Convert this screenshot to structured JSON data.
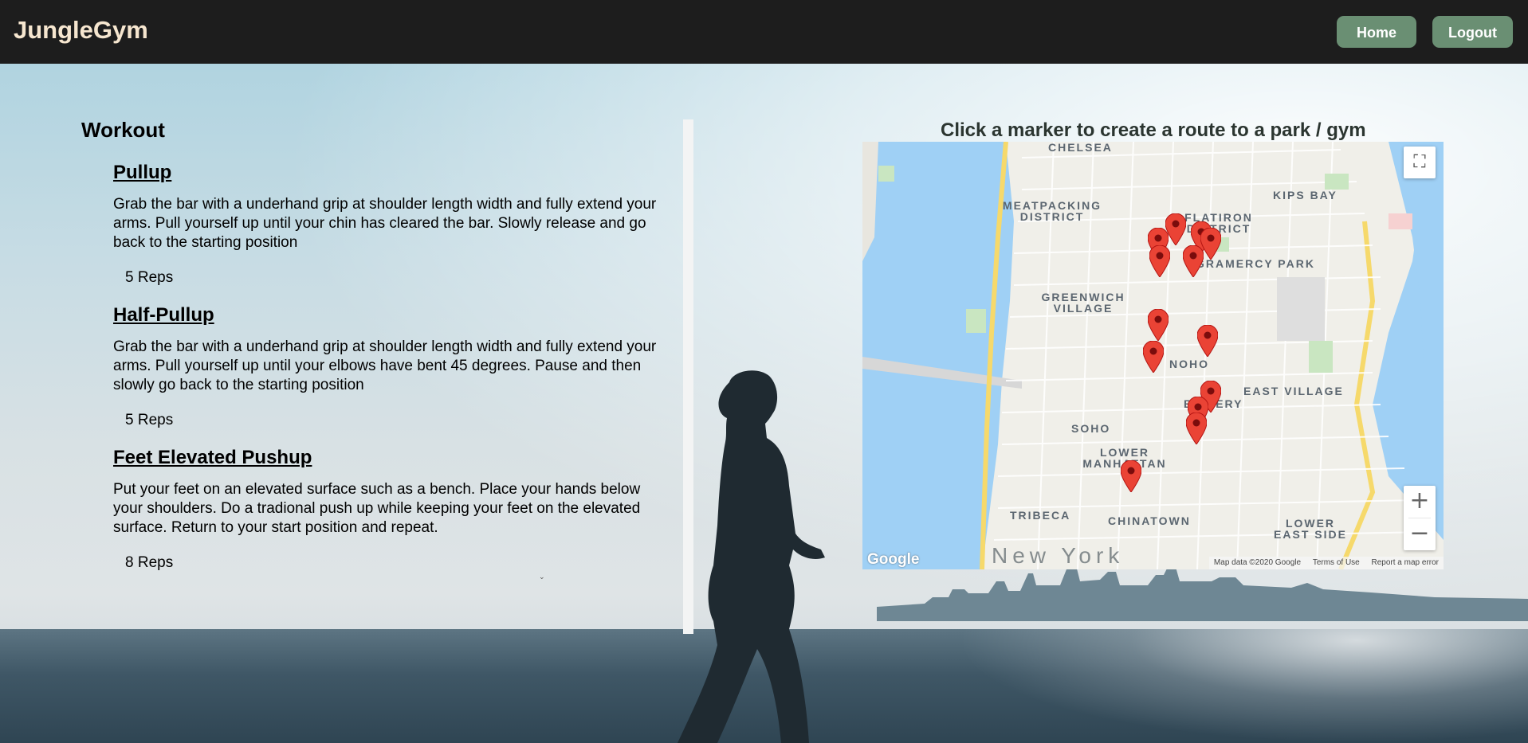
{
  "header": {
    "brand": "JungleGym",
    "home_label": "Home",
    "logout_label": "Logout"
  },
  "workout": {
    "heading": "Workout",
    "exercises": [
      {
        "title": "Pullup",
        "description": "Grab the bar with a underhand grip at shoulder length width and fully extend your arms. Pull yourself up until your chin has cleared the bar. Slowly release and go back to the starting position",
        "reps": "5 Reps"
      },
      {
        "title": "Half-Pullup",
        "description": "Grab the bar with a underhand grip at shoulder length width and fully extend your arms. Pull yourself up until your elbows have bent 45 degrees. Pause and then slowly go back to the starting position",
        "reps": "5 Reps"
      },
      {
        "title": "Feet Elevated Pushup",
        "description": "Put your feet on an elevated surface such as a bench. Place your hands below your shoulders. Do a tradional push up while keeping your feet on the elevated surface. Return to your start position and repeat.",
        "reps": "8 Reps"
      }
    ]
  },
  "map": {
    "caption": "Click a marker to create a route to a park / gym",
    "neighborhoods": [
      "CHELSEA",
      "MEATPACKING DISTRICT",
      "FLATIRON DISTRICT",
      "KIPS BAY",
      "GRAMERCY PARK",
      "GREENWICH VILLAGE",
      "NOHO",
      "EAST VILLAGE",
      "SOHO",
      "BOWERY",
      "LOWER MANHATTAN",
      "TRIBECA",
      "CHINATOWN",
      "LOWER EAST SIDE"
    ],
    "city": "New York",
    "attribution": "Map data ©2020 Google",
    "terms": "Terms of Use",
    "report": "Report a map error",
    "logo": "Google",
    "zoom_in": "+",
    "zoom_out": "−",
    "marker_color": "#ea4335",
    "water_color": "#9fd0f5",
    "marker_count": 13
  },
  "colors": {
    "navbar": "#1d1d1d",
    "brand": "#f6e6cf",
    "nav_button": "#6a8f73"
  }
}
